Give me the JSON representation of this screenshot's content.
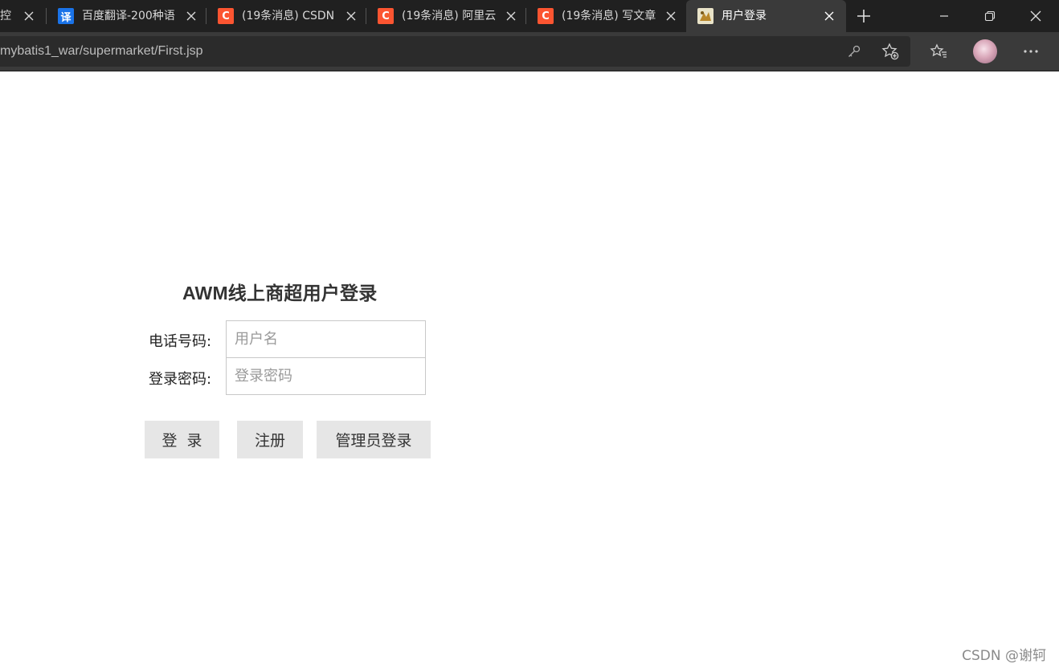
{
  "browser": {
    "tabs": [
      {
        "title": "控制",
        "favicon": "partial-tab-icon",
        "active": false
      },
      {
        "title": "百度翻译-200种语",
        "favicon": "baidu-translate-icon",
        "favicon_text": "译",
        "active": false
      },
      {
        "title": "(19条消息) CSDN",
        "favicon": "csdn-icon",
        "favicon_text": "C",
        "active": false
      },
      {
        "title": "(19条消息) 阿里云",
        "favicon": "csdn-icon",
        "favicon_text": "C",
        "active": false
      },
      {
        "title": "(19条消息) 写文章",
        "favicon": "csdn-icon",
        "favicon_text": "C",
        "active": false
      },
      {
        "title": "用户登录",
        "favicon": "page-icon",
        "active": true
      }
    ],
    "url": "mybatis1_war/supermarket/First.jsp",
    "colors": {
      "tabbar": "#202020",
      "active_tab": "#3a3a3a",
      "csdn": "#fc5531",
      "baidu": "#1a73e8"
    }
  },
  "login": {
    "title": "AWM线上商超用户登录",
    "phone_label": "电话号码:",
    "phone_placeholder": "用户名",
    "phone_value": "",
    "password_label": "登录密码:",
    "password_placeholder": "登录密码",
    "password_value": "",
    "buttons": {
      "login": "登  录",
      "register": "注册",
      "admin_login": "管理员登录"
    }
  },
  "watermark": "CSDN @谢轲"
}
